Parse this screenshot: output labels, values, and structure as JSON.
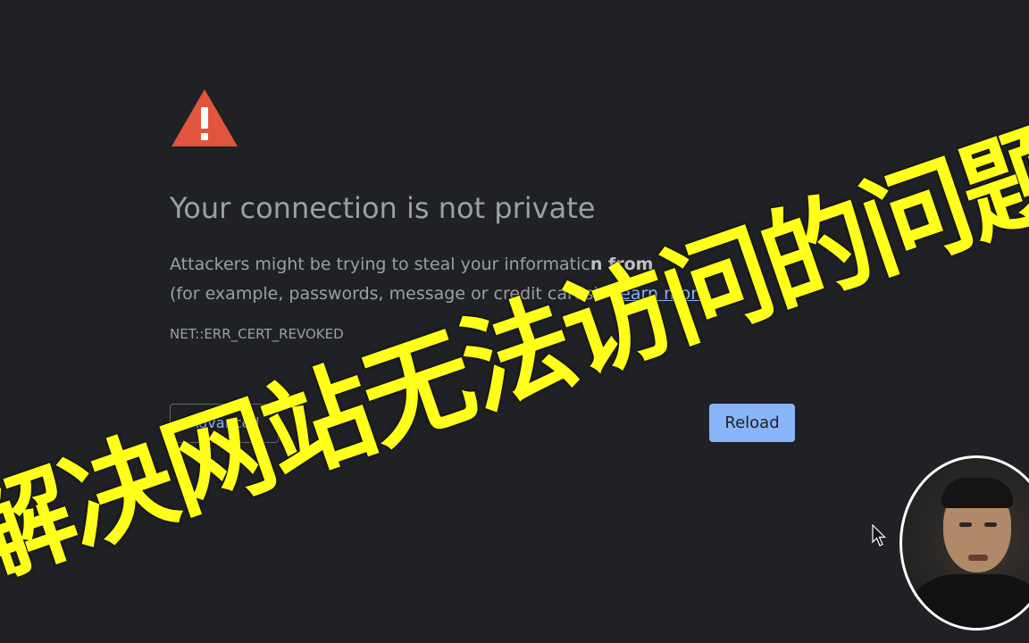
{
  "interstitial": {
    "title": "Your connection is not private",
    "body_line1_prefix": "Attackers might be trying to steal your informatic",
    "body_line1_host": "n from",
    "body_line2_prefix": "(for example, passwords, message",
    "body_line2_suffix": "or credit cards).",
    "learn_more_label": "Learn more",
    "error_code": "NET::ERR_CERT_REVOKED",
    "advanced_label": "Advanced",
    "reload_label": "Reload"
  },
  "overlay": {
    "caption": "解决网站无法访问的问题"
  },
  "colors": {
    "background": "#202124",
    "warning": "#e0553b",
    "reload_button": "#8ab4f8",
    "overlay_text": "#ffff1a"
  },
  "icons": {
    "warning": "warning-triangle-icon",
    "cursor": "mouse-pointer-icon"
  }
}
